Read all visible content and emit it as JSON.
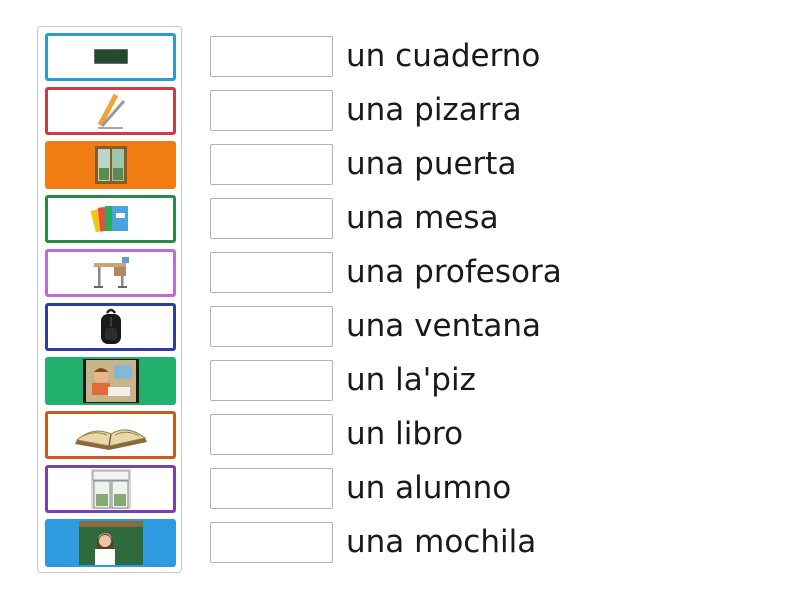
{
  "tiles": [
    {
      "icon": "blackboard-icon",
      "color": "#2b9bd6",
      "style": "outline"
    },
    {
      "icon": "pencil-icon",
      "color": "#d03a48",
      "style": "outline"
    },
    {
      "icon": "window-icon",
      "color": "#f07d12",
      "style": "filled"
    },
    {
      "icon": "notebooks-icon",
      "color": "#2b8a46",
      "style": "outline"
    },
    {
      "icon": "desk-icon",
      "color": "#c26ad6",
      "style": "outline"
    },
    {
      "icon": "backpack-icon",
      "color": "#2f3da1",
      "style": "outline"
    },
    {
      "icon": "student-icon",
      "color": "#22b06c",
      "style": "filled"
    },
    {
      "icon": "book-icon",
      "color": "#d0581f",
      "style": "outline"
    },
    {
      "icon": "door-icon",
      "color": "#7a3fb3",
      "style": "outline"
    },
    {
      "icon": "teacher-icon",
      "color": "#2e9be0",
      "style": "filled"
    }
  ],
  "words": [
    "un cuaderno",
    "una pizarra",
    "una puerta",
    "una mesa",
    "una profesora",
    "una ventana",
    "un la'piz",
    "un libro",
    "un alumno",
    "una mochila"
  ]
}
